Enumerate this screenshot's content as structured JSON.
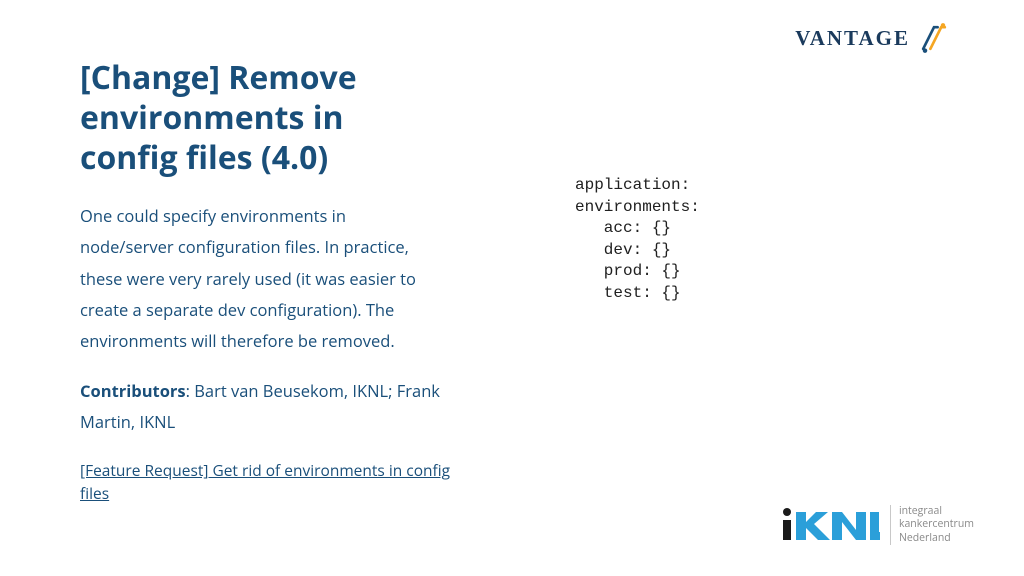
{
  "header": {
    "logo_text": "VANTAGE"
  },
  "title": "[Change] Remove environments in config files (4.0)",
  "body": "One could specify environments in node/server configuration files. In practice, these were very rarely used (it was easier to create a separate dev configuration). The environments will therefore be removed.",
  "contributors": {
    "label": "Contributors",
    "value": ": Bart van Beusekom, IKNL; Frank Martin, IKNL"
  },
  "link": {
    "text": "[Feature Request] Get rid of environments in config files"
  },
  "code": {
    "line1": "application:",
    "line2": "",
    "line3": "",
    "line4": "environments:",
    "line5": "   acc: {}",
    "line6": "   dev: {}",
    "line7": "   prod: {}",
    "line8": "   test: {}"
  },
  "footer_logo": {
    "tagline_l1": "integraal",
    "tagline_l2": "kankercentrum",
    "tagline_l3": "Nederland"
  }
}
